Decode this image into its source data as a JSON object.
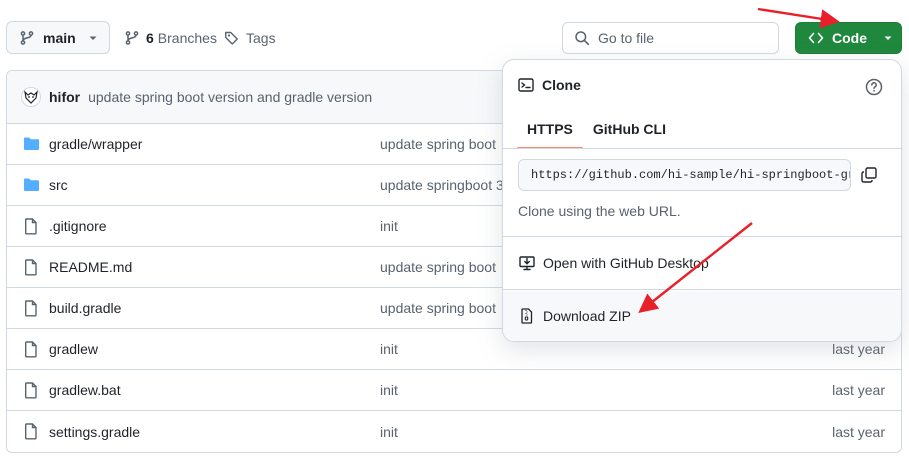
{
  "toolbar": {
    "branch_label": "main",
    "branches_count": "6",
    "branches_label": "Branches",
    "tags_label": "Tags",
    "go_to_file_placeholder": "Go to file",
    "code_button_label": "Code"
  },
  "commit": {
    "author": "hifor",
    "message": "update spring boot version and gradle version"
  },
  "files": [
    {
      "name": "gradle/wrapper",
      "type": "folder",
      "commit": "update spring boot",
      "age": ""
    },
    {
      "name": "src",
      "type": "folder",
      "commit": "update springboot 3",
      "age": ""
    },
    {
      "name": ".gitignore",
      "type": "file",
      "commit": "init",
      "age": ""
    },
    {
      "name": "README.md",
      "type": "file",
      "commit": "update spring boot",
      "age": ""
    },
    {
      "name": "build.gradle",
      "type": "file",
      "commit": "update spring boot",
      "age": ""
    },
    {
      "name": "gradlew",
      "type": "file",
      "commit": "init",
      "age": "last year"
    },
    {
      "name": "gradlew.bat",
      "type": "file",
      "commit": "init",
      "age": "last year"
    },
    {
      "name": "settings.gradle",
      "type": "file",
      "commit": "init",
      "age": "last year"
    }
  ],
  "clone_popover": {
    "title": "Clone",
    "tabs": [
      "HTTPS",
      "GitHub CLI"
    ],
    "active_tab": "HTTPS",
    "url": "https://github.com/hi-sample/hi-springboot-gradle.git",
    "note": "Clone using the web URL.",
    "open_desktop_label": "Open with GitHub Desktop",
    "download_zip_label": "Download ZIP"
  },
  "colors": {
    "accent_green": "#1f883d",
    "folder_blue": "#54aeff",
    "annotation_red": "#e8202a"
  }
}
